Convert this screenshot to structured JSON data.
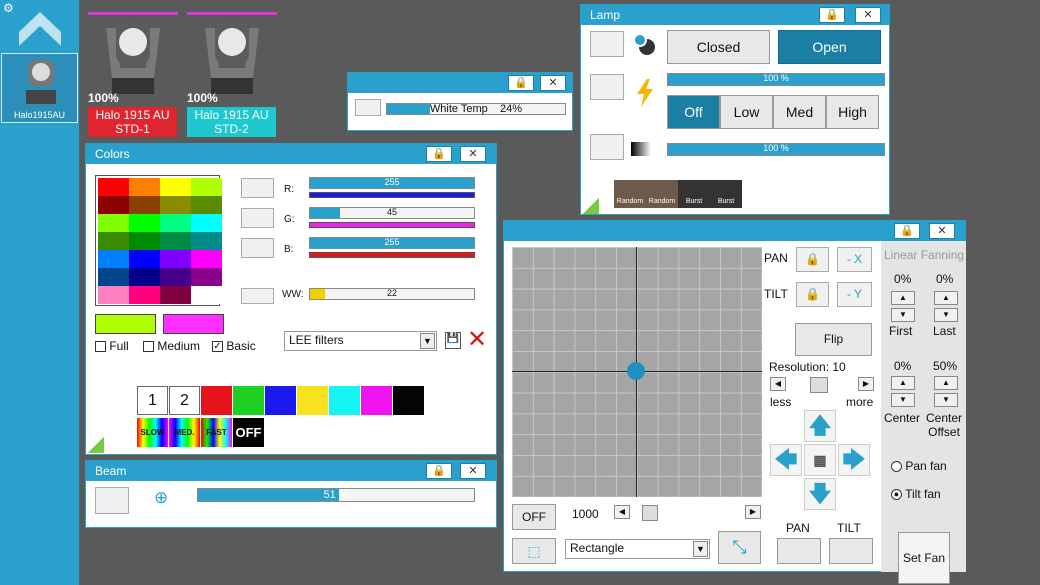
{
  "sidebar": {
    "fixture_label": "Halo1915AU"
  },
  "fixtures": [
    {
      "name": "Halo 1915AU STD-1",
      "line1": "Halo 1915 AU",
      "line2": "STD-1",
      "percent": "100%",
      "color": "#e0252e"
    },
    {
      "name": "Halo 1915AU STD-2",
      "line1": "Halo 1915 AU",
      "line2": "STD-2",
      "percent": "100%",
      "color": "#1ec8d0"
    }
  ],
  "white_temp": {
    "label": "White Temp",
    "value": "24%",
    "level": 0.24
  },
  "lamp": {
    "title": "Lamp",
    "closed": "Closed",
    "open": "Open",
    "intensity": "100 %",
    "off": "Off",
    "low": "Low",
    "med": "Med",
    "high": "High",
    "dimmer": "100 %",
    "effects": [
      "Random",
      "Random",
      "Burst",
      "Burst"
    ]
  },
  "colors": {
    "title": "Colors",
    "r_label": "R:",
    "g_label": "G:",
    "b_label": "B:",
    "ww_label": "WW:",
    "r": "255",
    "g": "45",
    "b": "255",
    "ww": "22",
    "r_level": 1.0,
    "g_level": 0.18,
    "b_level": 1.0,
    "ww_level": 0.09,
    "full": "Full",
    "medium": "Medium",
    "basic": "Basic",
    "filter": "LEE filters",
    "presets": [
      "1",
      "2"
    ],
    "preset_colors": [
      "#e8141c",
      "#1fd024",
      "#1a1aee",
      "#f8e21e",
      "#14f4f4",
      "#f014f0",
      "#050505"
    ],
    "speed": [
      "SLOW",
      "MED.",
      "FAST",
      "OFF"
    ],
    "palette": [
      "#ff0000",
      "#ff8000",
      "#ffff00",
      "#b0ff00",
      "#8b0000",
      "#8b4000",
      "#8b8b00",
      "#5a8b00",
      "#80ff00",
      "#00ff00",
      "#00ff80",
      "#00ffff",
      "#3a8b00",
      "#008b00",
      "#008b45",
      "#008b8b",
      "#0080ff",
      "#0000ff",
      "#8000ff",
      "#ff00ff",
      "#00458b",
      "#00008b",
      "#45008b",
      "#8b008b",
      "#ff80c0",
      "#ff0080",
      "#800040",
      "#ffffff"
    ],
    "swatch1": "#b0ff00",
    "swatch2": "#ff30ff"
  },
  "beam": {
    "title": "Beam",
    "value": "51 %",
    "level": 0.51
  },
  "pantilt": {
    "pan": "PAN",
    "tilt": "TILT",
    "neg_x": "- X",
    "neg_y": "- Y",
    "flip": "Flip",
    "resolution": "Resolution: 10",
    "less": "less",
    "more": "more",
    "off": "OFF",
    "speed": "1000",
    "shape": "Rectangle",
    "pan_btn": "PAN",
    "tilt_btn": "TILT",
    "fanning": {
      "title": "Linear Fanning",
      "first_pct": "0%",
      "last_pct": "0%",
      "first": "First",
      "last": "Last",
      "center_pct": "0%",
      "offset_pct": "50%",
      "center": "Center",
      "center2": "Center",
      "offset": "Offset",
      "pan_fan": "Pan fan",
      "tilt_fan": "Tilt fan",
      "set_fan": "Set Fan"
    }
  }
}
